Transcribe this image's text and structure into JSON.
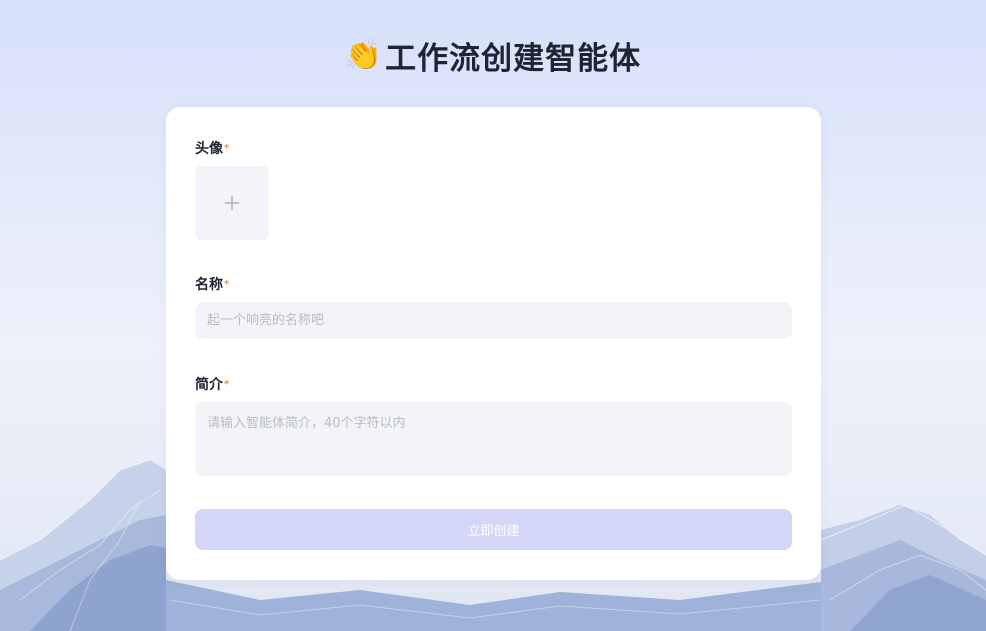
{
  "page": {
    "title": "工作流创建智能体",
    "title_emoji": "👏"
  },
  "form": {
    "avatar": {
      "label": "头像",
      "required_mark": "*",
      "upload_icon": "plus-icon"
    },
    "name": {
      "label": "名称",
      "required_mark": "*",
      "value": "",
      "placeholder": "起一个响亮的名称吧"
    },
    "description": {
      "label": "简介",
      "required_mark": "*",
      "value": "",
      "placeholder": "请输入智能体简介，40个字符以内"
    },
    "submit_label": "立即创建"
  },
  "colors": {
    "required_star": "#e59066",
    "submit_disabled_bg": "#d3d6f7",
    "field_bg": "#f3f4f7",
    "title_text": "#1f2433"
  }
}
